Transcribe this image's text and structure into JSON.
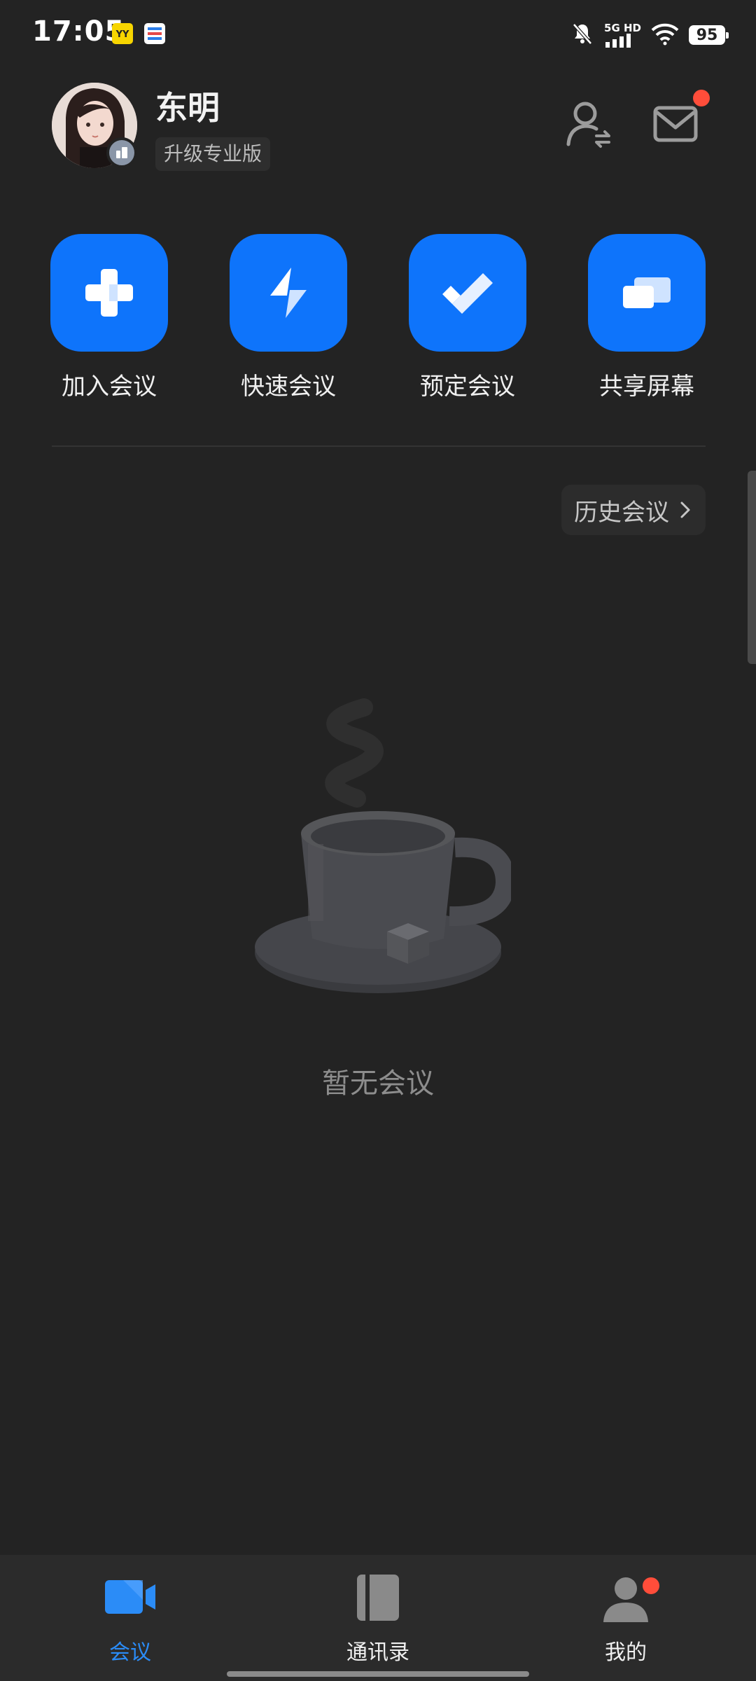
{
  "status_bar": {
    "time": "17:05",
    "network": "5G HD",
    "battery": "95"
  },
  "header": {
    "user_name": "东明",
    "upgrade_label": "升级专业版"
  },
  "actions": [
    {
      "label": "加入会议",
      "icon": "plus-icon"
    },
    {
      "label": "快速会议",
      "icon": "lightning-icon"
    },
    {
      "label": "预定会议",
      "icon": "checkmark-icon"
    },
    {
      "label": "共享屏幕",
      "icon": "share-screen-icon"
    }
  ],
  "history_label": "历史会议",
  "empty_text": "暂无会议",
  "nav": {
    "items": [
      {
        "label": "会议",
        "icon": "video-camera-icon",
        "active": true
      },
      {
        "label": "通讯录",
        "icon": "contacts-book-icon",
        "active": false
      },
      {
        "label": "我的",
        "icon": "profile-icon",
        "active": false
      }
    ]
  },
  "colors": {
    "background": "#232323",
    "accent": "#0e74fb",
    "nav_active": "#2b8cf7",
    "notification": "#ff4d3a"
  }
}
